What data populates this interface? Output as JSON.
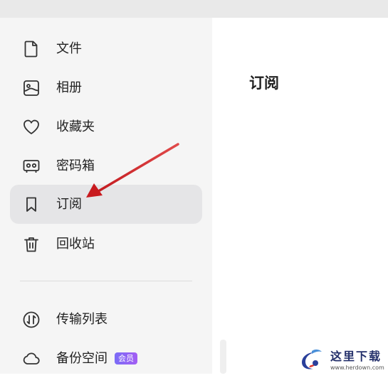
{
  "sidebar": {
    "items": [
      {
        "label": "文件",
        "icon": "file-icon"
      },
      {
        "label": "相册",
        "icon": "photo-album-icon"
      },
      {
        "label": "收藏夹",
        "icon": "heart-icon"
      },
      {
        "label": "密码箱",
        "icon": "safe-box-icon"
      },
      {
        "label": "订阅",
        "icon": "bookmark-icon",
        "active": true
      },
      {
        "label": "回收站",
        "icon": "trash-icon"
      },
      {
        "label": "传输列表",
        "icon": "transfer-icon"
      },
      {
        "label": "备份空间",
        "icon": "cloud-icon",
        "badge": "会员"
      }
    ]
  },
  "main": {
    "title": "订阅"
  },
  "watermark": {
    "title": "这里下载",
    "url": "www.herdown.com"
  },
  "colors": {
    "sidebar_bg": "#f5f5f5",
    "active_bg": "#e5e5e7",
    "arrow": "#d11c1c",
    "badge": "#8b63f4"
  }
}
